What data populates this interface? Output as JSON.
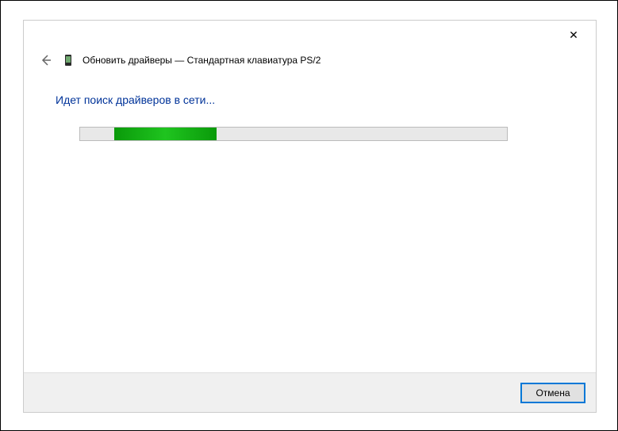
{
  "header": {
    "title": "Обновить драйверы — Стандартная клавиатура PS/2"
  },
  "content": {
    "status": "Идет поиск драйверов в сети...",
    "progress": {
      "left_percent": 8,
      "width_percent": 24
    }
  },
  "footer": {
    "cancel_label": "Отмена"
  },
  "icons": {
    "close": "✕",
    "back": "←"
  }
}
